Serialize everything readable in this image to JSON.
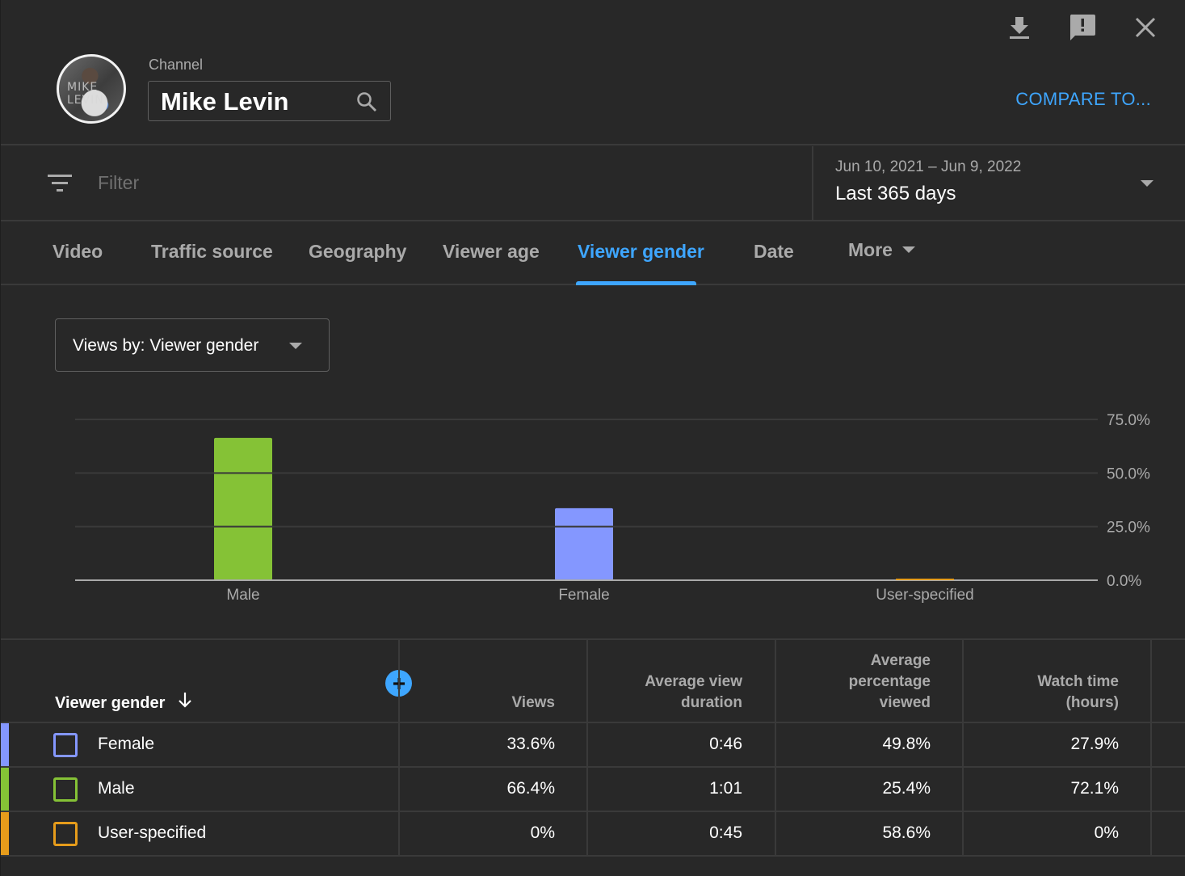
{
  "header": {
    "channel_label": "Channel",
    "channel_name": "Mike Levin",
    "compare_label": "COMPARE TO...",
    "icons": [
      "download-icon",
      "feedback-icon",
      "close-icon"
    ],
    "avatar_text": "MIKE LEVIN"
  },
  "filter": {
    "placeholder": "Filter",
    "date_range": "Jun 10, 2021 – Jun 9, 2022",
    "date_label": "Last 365 days"
  },
  "tabs": [
    {
      "label": "Video",
      "active": false
    },
    {
      "label": "Traffic source",
      "active": false
    },
    {
      "label": "Geography",
      "active": false
    },
    {
      "label": "Viewer age",
      "active": false
    },
    {
      "label": "Viewer gender",
      "active": true
    },
    {
      "label": "Date",
      "active": false
    },
    {
      "label": "More",
      "active": false
    }
  ],
  "metric_selector": {
    "label": "Views by: Viewer gender"
  },
  "colors": {
    "accent": "#3ea6ff",
    "male": "#85c236",
    "female": "#8497ff",
    "user_specified": "#e69c1b"
  },
  "chart_data": {
    "type": "bar",
    "title": "Views by: Viewer gender",
    "xlabel": "",
    "ylabel": "",
    "categories": [
      "Male",
      "Female",
      "User-specified"
    ],
    "values": [
      66.4,
      33.6,
      0.0
    ],
    "colors": [
      "#85c236",
      "#8497ff",
      "#e69c1b"
    ],
    "ylim": [
      0,
      75
    ],
    "yticks": [
      0,
      25,
      50,
      75
    ],
    "ytick_labels": [
      "0.0%",
      "25.0%",
      "50.0%",
      "75.0%"
    ],
    "y_axis_position": "right",
    "grid": true,
    "legend": "none"
  },
  "table": {
    "columns": [
      "Viewer gender",
      "Views",
      "Average view duration",
      "Average percentage viewed",
      "Watch time (hours)"
    ],
    "column_lines": [
      [
        "Viewer gender"
      ],
      [
        "Views"
      ],
      [
        "Average view",
        "duration"
      ],
      [
        "Average",
        "percentage",
        "viewed"
      ],
      [
        "Watch time",
        "(hours)"
      ]
    ],
    "sort_column": "Viewer gender",
    "sort_direction": "descending",
    "rows": [
      {
        "label": "Female",
        "color": "#8497ff",
        "views": "33.6%",
        "avg_view_duration": "0:46",
        "avg_pct_viewed": "49.8%",
        "watch_time": "27.9%"
      },
      {
        "label": "Male",
        "color": "#85c236",
        "views": "66.4%",
        "avg_view_duration": "1:01",
        "avg_pct_viewed": "25.4%",
        "watch_time": "72.1%"
      },
      {
        "label": "User-specified",
        "color": "#e69c1b",
        "views": "0%",
        "avg_view_duration": "0:45",
        "avg_pct_viewed": "58.6%",
        "watch_time": "0%"
      }
    ]
  }
}
